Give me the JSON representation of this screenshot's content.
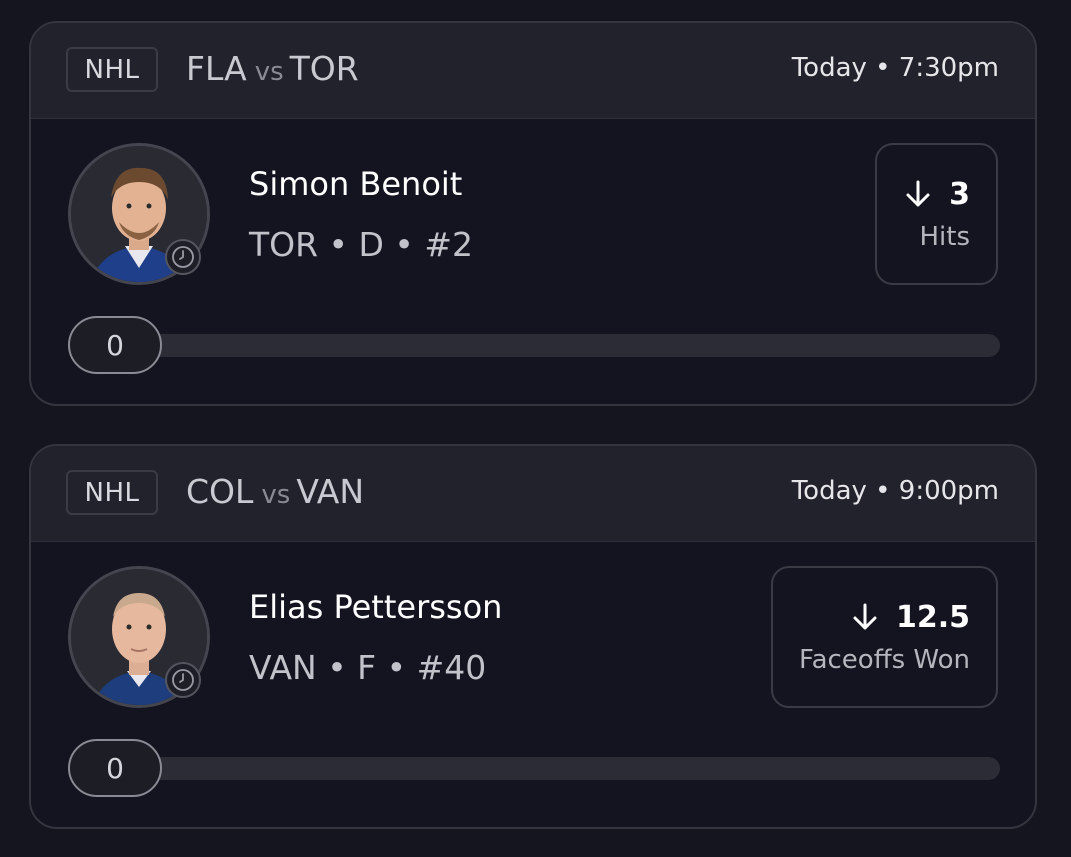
{
  "cards": [
    {
      "league": "NHL",
      "matchup": {
        "away": "FLA",
        "vs": "vs",
        "home": "TOR"
      },
      "game_time": "Today • 7:30pm",
      "player": {
        "name": "Simon Benoit",
        "meta": "TOR • D • #2"
      },
      "stat": {
        "direction_icon": "arrow-down-icon",
        "line": "3",
        "label": "Hits"
      },
      "progress": {
        "value": "0",
        "fraction": 0
      }
    },
    {
      "league": "NHL",
      "matchup": {
        "away": "COL",
        "vs": "vs",
        "home": "VAN"
      },
      "game_time": "Today • 9:00pm",
      "player": {
        "name": "Elias Pettersson",
        "meta": "VAN • F • #40"
      },
      "stat": {
        "direction_icon": "arrow-down-icon",
        "line": "12.5",
        "label": "Faceoffs Won"
      },
      "progress": {
        "value": "0",
        "fraction": 0
      }
    }
  ],
  "colors": {
    "background": "#15151f",
    "card_header": "#22222c",
    "card_border": "#35353f",
    "progress_track": "#2c2c36"
  }
}
